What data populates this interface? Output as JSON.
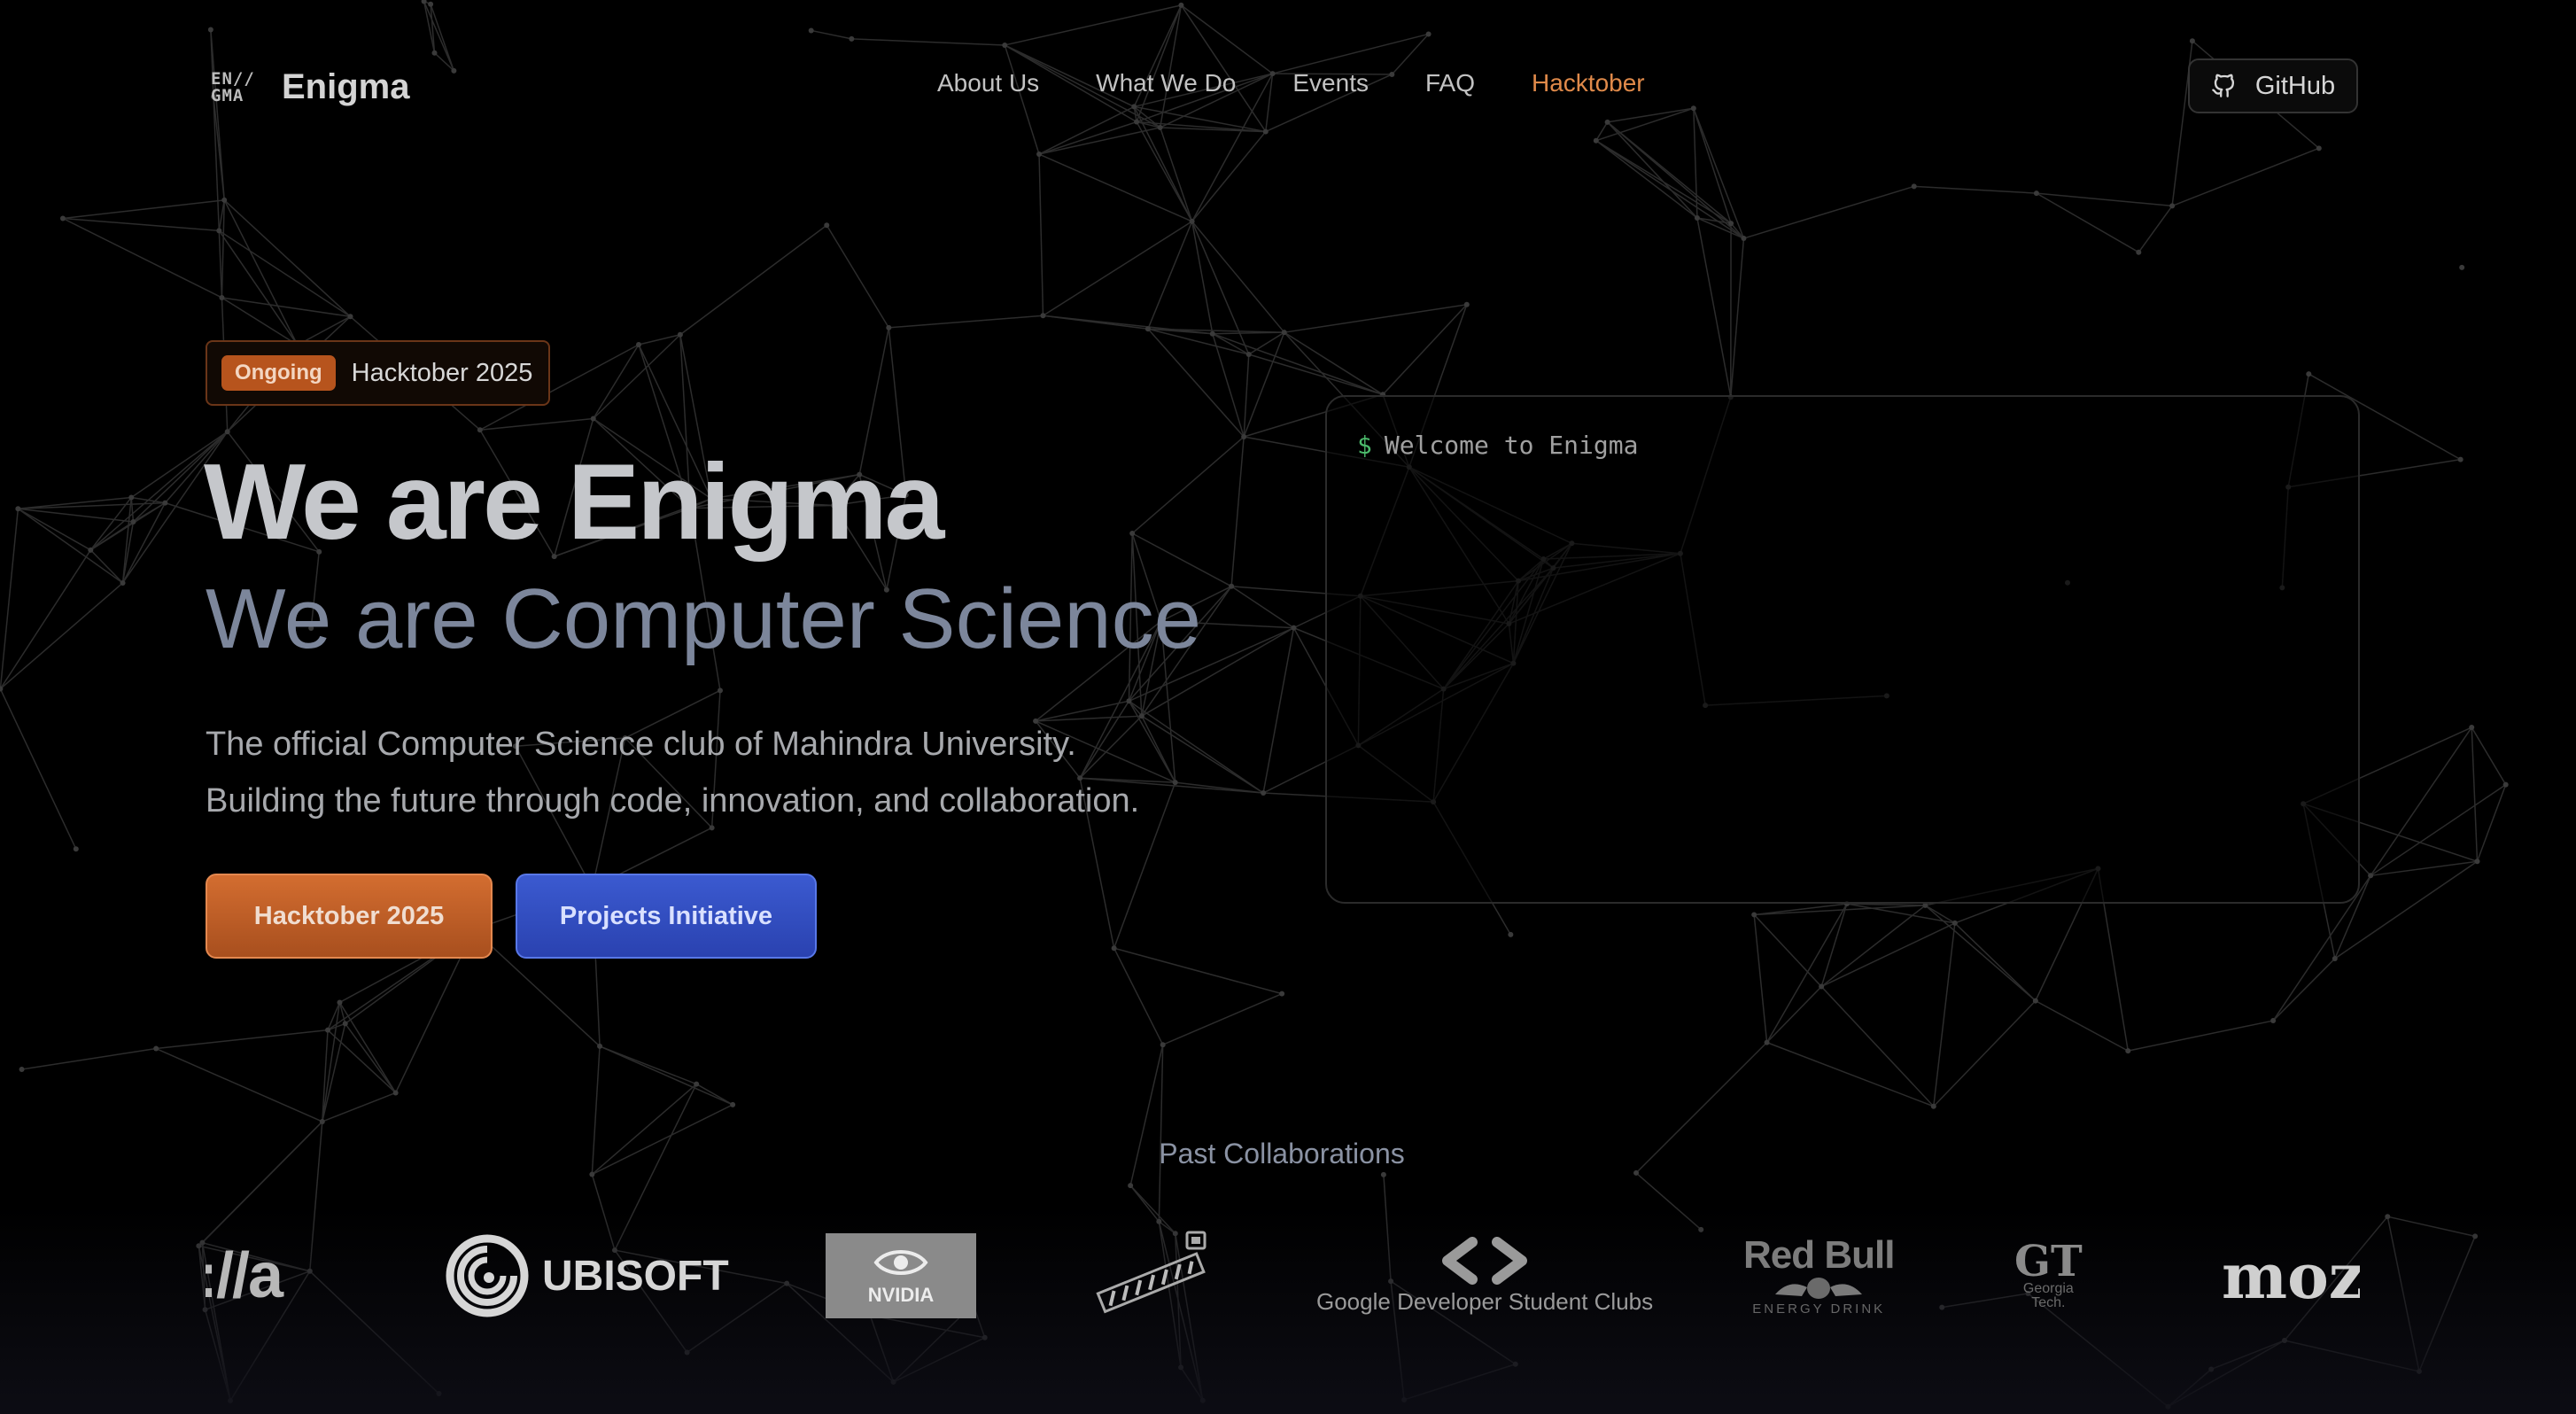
{
  "brand": {
    "logo_mark": "EN//\nGMA",
    "name": "Enigma"
  },
  "nav": {
    "items": [
      "About Us",
      "What We Do",
      "Events",
      "FAQ",
      "Hacktober"
    ],
    "active": "Hacktober",
    "active_color": "#e08a4a"
  },
  "github": {
    "label": "GitHub",
    "icon": "github-icon"
  },
  "hero": {
    "badge": {
      "pill": "Ongoing",
      "text": "Hacktober 2025"
    },
    "title": "We are Enigma",
    "subtitle": "We are Computer Science",
    "description": [
      "The official Computer Science club of Mahindra University.",
      "Building the future through code, innovation, and collaboration."
    ],
    "buttons": {
      "primary": "Hacktober 2025",
      "secondary": "Projects Initiative"
    }
  },
  "terminal": {
    "prompt": "$",
    "text": "Welcome to Enigma"
  },
  "collaborations": {
    "title": "Past Collaborations",
    "partners": {
      "mozilla_partial": "://a",
      "ubisoft": "UBISOFT",
      "nvidia": "NVIDIA",
      "gdsc": "Google Developer Student Clubs",
      "redbull": {
        "name": "Red Bull",
        "sub": "ENERGY DRINK"
      },
      "gt": {
        "mark": "GT",
        "sub": "Georgia\nTech."
      },
      "mozilla_partial_right": "moz"
    }
  },
  "colors": {
    "accent_orange": "#b7541d",
    "accent_blue": "#2f4bc0",
    "background": "#000000"
  }
}
